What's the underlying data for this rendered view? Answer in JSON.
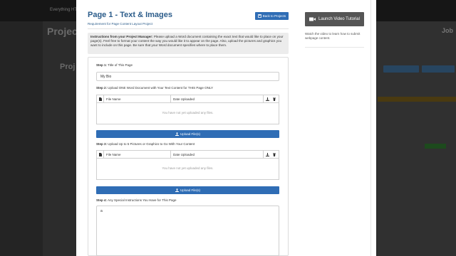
{
  "background": {
    "brand": "Everything HTML",
    "title": "Project",
    "subtitle": "Proj",
    "right_title": "Job"
  },
  "modal": {
    "title": "Page 1 - Text & Images",
    "subtitle": "Requirement for Page Content Layout Project",
    "back_button_label": "Back to Projects",
    "instructions_heading": "Instructions from your Project Manager:",
    "instructions_body": " Please upload a Word document containing the exact text that would like to place on your page(s). Feel free to format your content the way you would like it to appear on the page. Also, upload the pictures and graphics you want to include on this page. Be sure that your Word document specifies where to place them."
  },
  "steps": {
    "step1": {
      "number": "Step 1:",
      "label": " Title of This Page",
      "value": "My Bio"
    },
    "step2": {
      "number": "Step 2:",
      "label": " Upload ONE Word Document with Your Text Content for THIS Page ONLY",
      "columns": [
        "File Name",
        "Date Uploaded"
      ],
      "empty_message": "You have not yet uploaded any files.",
      "upload_label": "Upload File(s)"
    },
    "step3": {
      "number": "Step 3:",
      "label": " Upload Up to 5 Pictures or Graphics to Go With Your Content",
      "columns": [
        "File Name",
        "Date Uploaded"
      ],
      "empty_message": "You have not yet uploaded any files.",
      "upload_label": "Upload File(s)"
    },
    "step4": {
      "number": "Step 4:",
      "label": " Any Special Instructions You Have for This Page",
      "value": "a"
    }
  },
  "side": {
    "video_button_label": "Launch Video Tutorial",
    "video_hint": "Watch the video to learn how to submit webpage content."
  },
  "colors": {
    "accent": "#2f6db5",
    "title": "#2b5c8a",
    "video_button": "#555555"
  },
  "icons": [
    "file-icon",
    "download-icon",
    "trash-icon",
    "upload-icon",
    "video-camera-icon",
    "save-icon"
  ]
}
